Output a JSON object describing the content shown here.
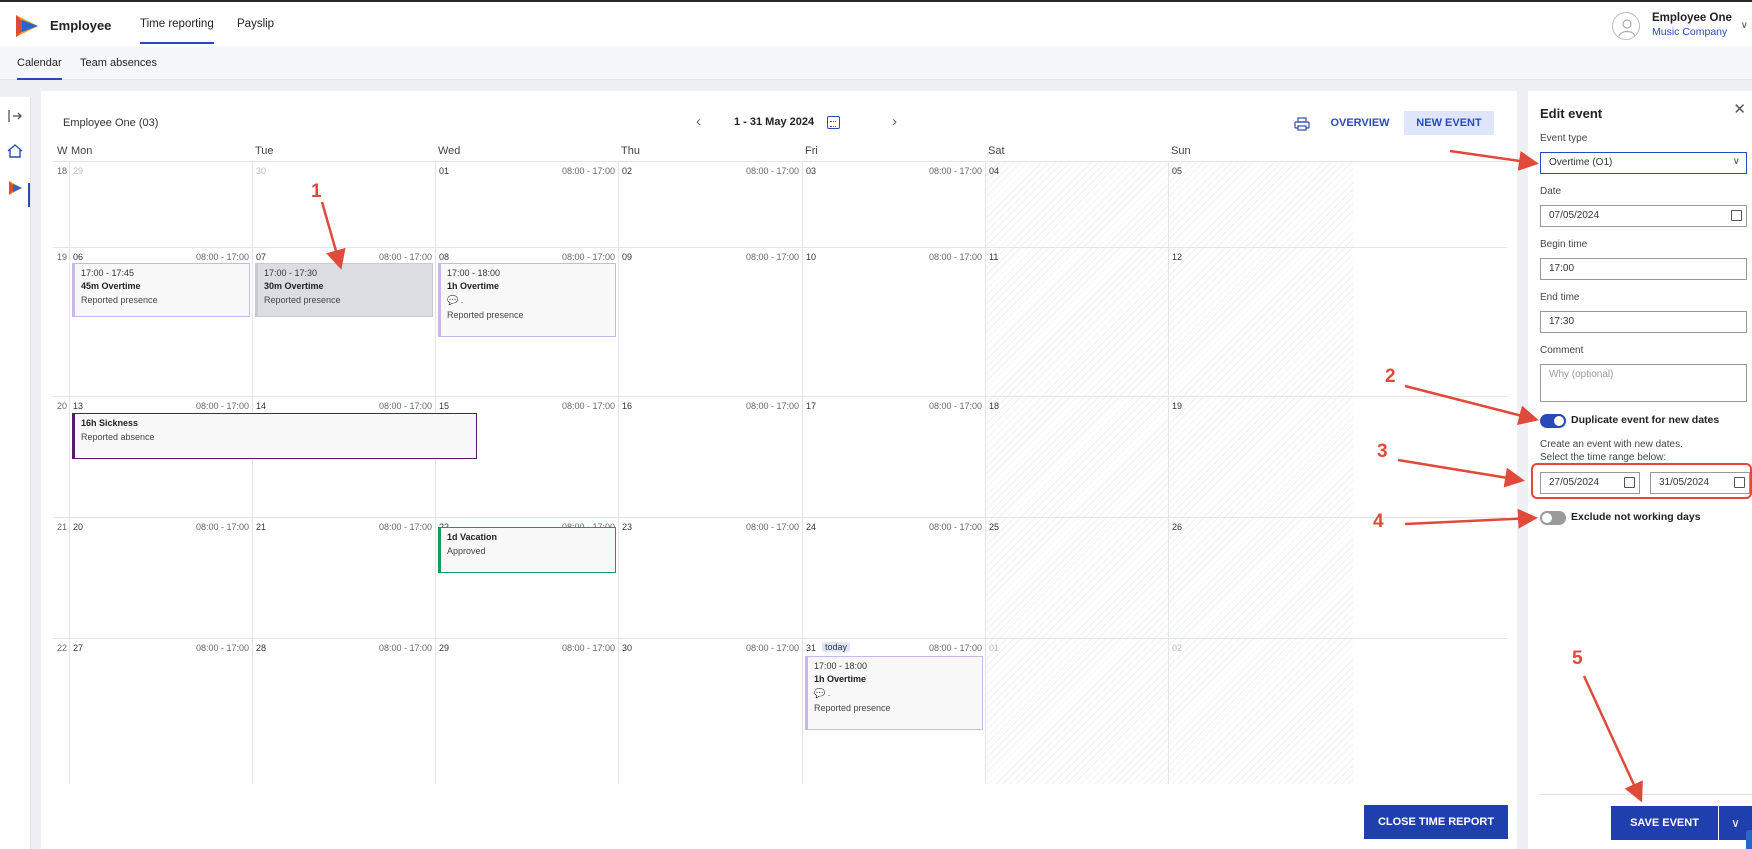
{
  "app": {
    "name": "Employee"
  },
  "top_tabs": [
    {
      "label": "Time reporting",
      "active": true
    },
    {
      "label": "Payslip",
      "active": false
    }
  ],
  "user": {
    "name": "Employee One",
    "company": "Music Company"
  },
  "sub_tabs": [
    {
      "label": "Calendar",
      "active": true
    },
    {
      "label": "Team absences",
      "active": false
    }
  ],
  "calendar": {
    "owner": "Employee One (03)",
    "month_label": "1 - 31 May 2024",
    "overview_label": "OVERVIEW",
    "new_event_label": "NEW EVENT",
    "week_header": "W",
    "day_headers": [
      "Mon",
      "Tue",
      "Wed",
      "Thu",
      "Fri",
      "Sat",
      "Sun"
    ],
    "weeks": [
      {
        "week": "18",
        "days": [
          {
            "num": "29",
            "muted": true,
            "hours": ""
          },
          {
            "num": "30",
            "muted": true,
            "hours": ""
          },
          {
            "num": "01",
            "hours": "08:00 - 17:00"
          },
          {
            "num": "02",
            "hours": "08:00 - 17:00"
          },
          {
            "num": "03",
            "hours": "08:00 - 17:00"
          },
          {
            "num": "04",
            "hours": ""
          },
          {
            "num": "05",
            "hours": ""
          }
        ]
      },
      {
        "week": "19",
        "days": [
          {
            "num": "06",
            "hours": "08:00 - 17:00"
          },
          {
            "num": "07",
            "hours": "08:00 - 17:00"
          },
          {
            "num": "08",
            "hours": "08:00 - 17:00"
          },
          {
            "num": "09",
            "hours": "08:00 - 17:00"
          },
          {
            "num": "10",
            "hours": "08:00 - 17:00"
          },
          {
            "num": "11",
            "hours": ""
          },
          {
            "num": "12",
            "hours": ""
          }
        ]
      },
      {
        "week": "20",
        "days": [
          {
            "num": "13",
            "hours": "08:00 - 17:00"
          },
          {
            "num": "14",
            "hours": "08:00 - 17:00"
          },
          {
            "num": "15",
            "hours": "08:00 - 17:00"
          },
          {
            "num": "16",
            "hours": "08:00 - 17:00"
          },
          {
            "num": "17",
            "hours": "08:00 - 17:00"
          },
          {
            "num": "18",
            "hours": ""
          },
          {
            "num": "19",
            "hours": ""
          }
        ]
      },
      {
        "week": "21",
        "days": [
          {
            "num": "20",
            "hours": "08:00 - 17:00"
          },
          {
            "num": "21",
            "hours": "08:00 - 17:00"
          },
          {
            "num": "22",
            "hours": "08:00 - 17:00"
          },
          {
            "num": "23",
            "hours": "08:00 - 17:00"
          },
          {
            "num": "24",
            "hours": "08:00 - 17:00"
          },
          {
            "num": "25",
            "hours": ""
          },
          {
            "num": "26",
            "hours": ""
          }
        ]
      },
      {
        "week": "22",
        "days": [
          {
            "num": "27",
            "hours": "08:00 - 17:00"
          },
          {
            "num": "28",
            "hours": "08:00 - 17:00"
          },
          {
            "num": "29",
            "hours": "08:00 - 17:00"
          },
          {
            "num": "30",
            "hours": "08:00 - 17:00"
          },
          {
            "num": "31",
            "hours": "08:00 - 17:00",
            "today": "today"
          },
          {
            "num": "01",
            "muted": true,
            "hours": ""
          },
          {
            "num": "02",
            "muted": true,
            "hours": ""
          }
        ]
      }
    ],
    "events": {
      "e1": {
        "time": "17:00 - 17:45",
        "title": "45m Overtime",
        "status": "Reported presence"
      },
      "e2": {
        "time": "17:00 - 17:30",
        "title": "30m Overtime",
        "status": "Reported presence"
      },
      "e3": {
        "time": "17:00 - 18:00",
        "title": "1h Overtime",
        "comment": "💬 .",
        "status": "Reported presence"
      },
      "e4": {
        "title": "16h Sickness",
        "status": "Reported absence"
      },
      "e5": {
        "title": "1d Vacation",
        "status": "Approved"
      },
      "e6": {
        "time": "17:00 - 18:00",
        "title": "1h Overtime",
        "comment": "💬 .",
        "status": "Reported presence"
      }
    },
    "close_report_label": "CLOSE TIME REPORT"
  },
  "edit_panel": {
    "title": "Edit event",
    "event_type_label": "Event type",
    "event_type_value": "Overtime (O1)",
    "date_label": "Date",
    "date_value": "07/05/2024",
    "begin_label": "Begin time",
    "begin_value": "17:00",
    "end_label": "End time",
    "end_value": "17:30",
    "comment_label": "Comment",
    "comment_placeholder": "Why (optional)",
    "duplicate_label": "Duplicate event for new dates",
    "duplicate_on": true,
    "hint_line1": "Create an event with new dates.",
    "hint_line2": "Select the time range below:",
    "range_from": "27/05/2024",
    "range_to": "31/05/2024",
    "exclude_label": "Exclude not working days",
    "exclude_on": false,
    "save_label": "SAVE EVENT"
  },
  "annotations": [
    "1",
    "2",
    "3",
    "4",
    "5"
  ],
  "colors": {
    "accent": "#2a49b8",
    "button": "#1f3fae",
    "annotation": "#e04a3a"
  }
}
